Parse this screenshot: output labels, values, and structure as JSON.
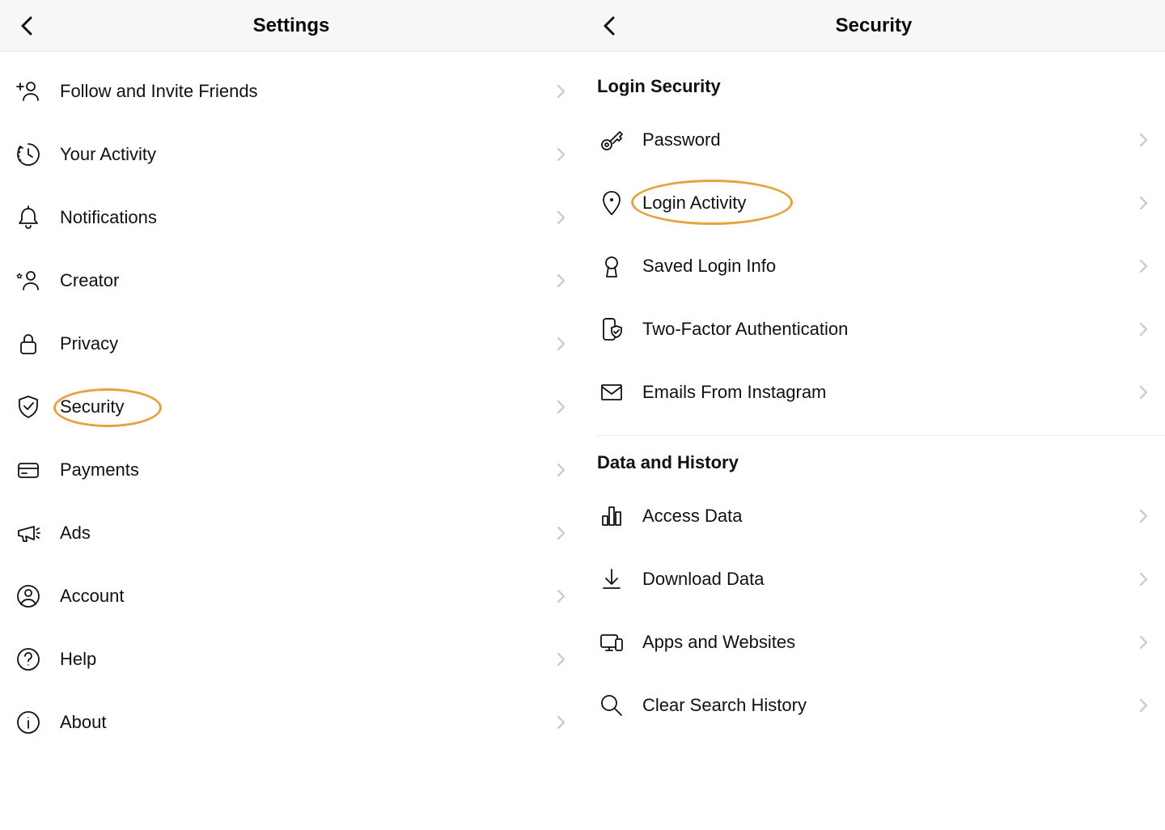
{
  "left": {
    "title": "Settings",
    "items": [
      {
        "label": "Follow and Invite Friends"
      },
      {
        "label": "Your Activity"
      },
      {
        "label": "Notifications"
      },
      {
        "label": "Creator"
      },
      {
        "label": "Privacy"
      },
      {
        "label": "Security"
      },
      {
        "label": "Payments"
      },
      {
        "label": "Ads"
      },
      {
        "label": "Account"
      },
      {
        "label": "Help"
      },
      {
        "label": "About"
      }
    ]
  },
  "right": {
    "title": "Security",
    "sections": {
      "login_security": "Login Security",
      "data_history": "Data and History"
    },
    "login_items": [
      {
        "label": "Password"
      },
      {
        "label": "Login Activity"
      },
      {
        "label": "Saved Login Info"
      },
      {
        "label": "Two-Factor Authentication"
      },
      {
        "label": "Emails From Instagram"
      }
    ],
    "data_items": [
      {
        "label": "Access Data"
      },
      {
        "label": "Download Data"
      },
      {
        "label": "Apps and Websites"
      },
      {
        "label": "Clear Search History"
      }
    ]
  },
  "highlight_color": "#e6a23c"
}
